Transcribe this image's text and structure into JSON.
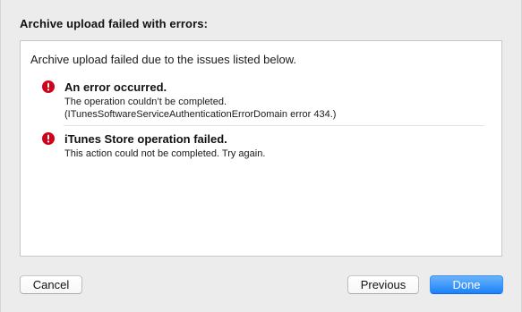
{
  "dialog": {
    "title": "Archive upload failed with errors:",
    "summary": "Archive upload failed due to the issues listed below."
  },
  "issues": [
    {
      "icon": "error-icon",
      "title": "An error occurred.",
      "lines": [
        "The operation couldn’t be completed.",
        "(ITunesSoftwareServiceAuthenticationErrorDomain error 434.)"
      ]
    },
    {
      "icon": "error-icon",
      "title": "iTunes Store operation failed.",
      "lines": [
        "This action could not be completed. Try again."
      ]
    }
  ],
  "buttons": {
    "cancel": "Cancel",
    "previous": "Previous",
    "done": "Done"
  },
  "colors": {
    "error_red": "#d0021b",
    "accent_blue": "#1a82fb",
    "window_bg": "#ececec"
  }
}
